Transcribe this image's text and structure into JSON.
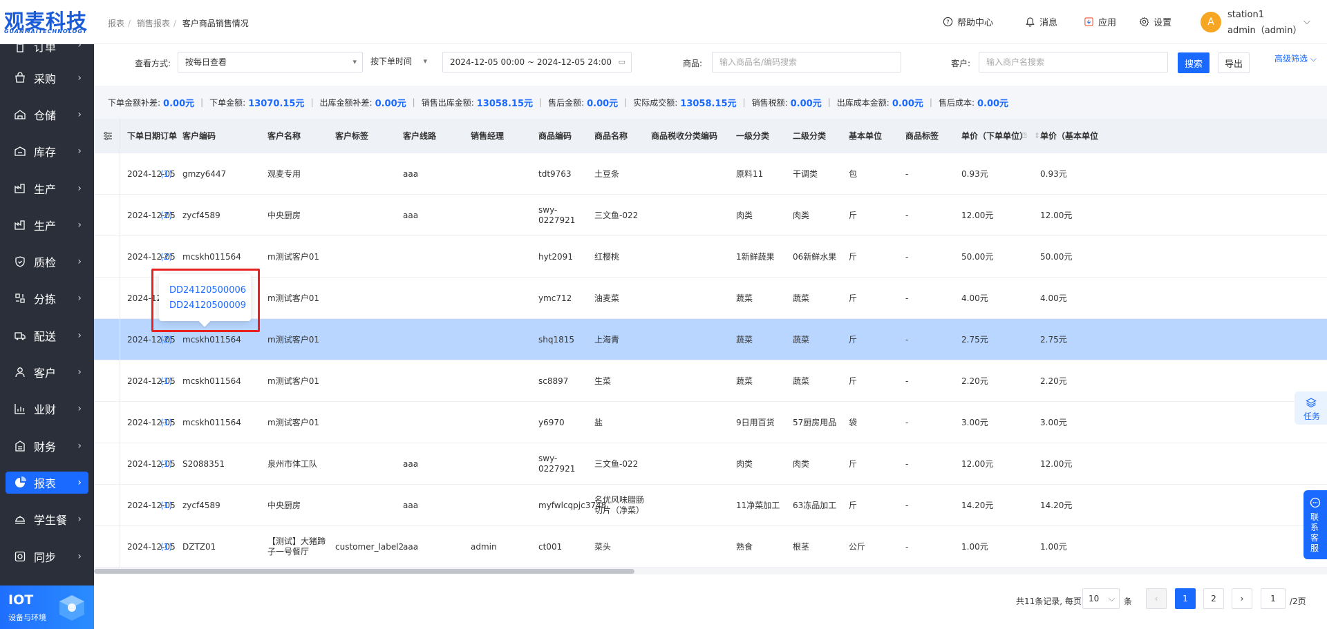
{
  "brand": {
    "name_cn": "观麦科技",
    "name_en": "GUANMAITECHNOLOGY",
    "color": "#1a5bd9"
  },
  "sidebar": {
    "items": [
      {
        "label": "订单",
        "icon": "clipboard-icon"
      },
      {
        "label": "采购",
        "icon": "bag-icon"
      },
      {
        "label": "仓储",
        "icon": "warehouse-icon"
      },
      {
        "label": "库存",
        "icon": "inventory-icon"
      },
      {
        "label": "生产",
        "icon": "factory-icon"
      },
      {
        "label": "生产",
        "icon": "factory-icon"
      },
      {
        "label": "质检",
        "icon": "shield-icon"
      },
      {
        "label": "分拣",
        "icon": "sort-icon"
      },
      {
        "label": "配送",
        "icon": "truck-icon"
      },
      {
        "label": "客户",
        "icon": "user-icon"
      },
      {
        "label": "业财",
        "icon": "chart-bar-icon"
      },
      {
        "label": "财务",
        "icon": "finance-icon"
      },
      {
        "label": "报表",
        "icon": "pie-chart-icon"
      },
      {
        "label": "学生餐",
        "icon": "meal-icon"
      },
      {
        "label": "同步",
        "icon": "sync-icon"
      }
    ],
    "active_index": 12,
    "iot": {
      "title": "IOT",
      "subtitle": "设备与环境"
    }
  },
  "header": {
    "breadcrumb": [
      "报表",
      "销售报表",
      "客户商品销售情况"
    ],
    "help": "帮助中心",
    "messages": "消息",
    "apps": "应用",
    "settings": "设置",
    "user": {
      "avatar_letter": "A",
      "name": "station1",
      "role": "admin（admin）"
    }
  },
  "filters": {
    "view_label": "查看方式:",
    "view_value": "按每日查看",
    "time_type": "按下单时间",
    "date_range": "2024-12-05 00:00 ~ 2024-12-05 24:00",
    "product_label": "商品:",
    "product_placeholder": "输入商品名/编码搜索",
    "customer_label": "客户:",
    "customer_placeholder": "输入商户名搜索",
    "search_btn": "搜索",
    "export_btn": "导出",
    "advanced": "高级筛选"
  },
  "summary": [
    {
      "label": "下单金额补差:",
      "value": "0.00元"
    },
    {
      "label": "下单金额:",
      "value": "13070.15元"
    },
    {
      "label": "出库金额补差:",
      "value": "0.00元"
    },
    {
      "label": "销售出库金额:",
      "value": "13058.15元"
    },
    {
      "label": "售后金额:",
      "value": "0.00元"
    },
    {
      "label": "实际成交额:",
      "value": "13058.15元"
    },
    {
      "label": "销售税额:",
      "value": "0.00元"
    },
    {
      "label": "出库成本金额:",
      "value": "0.00元"
    },
    {
      "label": "售后成本:",
      "value": "0.00元"
    }
  ],
  "table": {
    "columns": [
      "下单日期",
      "订单",
      "客户编码",
      "客户名称",
      "客户标签",
      "客户线路",
      "销售经理",
      "商品编码",
      "商品名称",
      "商品税收分类编码",
      "一级分类",
      "二级分类",
      "基本单位",
      "商品标签",
      "单价（下单单位）",
      "单价（基本单位"
    ],
    "rows": [
      [
        "2024-12-05",
        "(1)",
        "gmzy6447",
        "观麦专用",
        "",
        "aaa",
        "",
        "tdt9763",
        "土豆条",
        "",
        "原料11",
        "干调类",
        "包",
        "-",
        "0.93元",
        "0.93元"
      ],
      [
        "2024-12-05",
        "(2)",
        "zycf4589",
        "中央厨房",
        "",
        "aaa",
        "",
        "swy-0227921",
        "三文鱼-022",
        "",
        "肉类",
        "肉类",
        "斤",
        "-",
        "12.00元",
        "12.00元"
      ],
      [
        "2024-12-05",
        "(2)",
        "mcskh011564",
        "m测试客户01",
        "",
        "",
        "",
        "hyt2091",
        "红樱桃",
        "",
        "1新鲜蔬果",
        "06新鲜水果",
        "斤",
        "-",
        "50.00元",
        "50.00元"
      ],
      [
        "2024-12-05",
        "(2)",
        "mcskh011564",
        "m测试客户01",
        "",
        "",
        "",
        "ymc712",
        "油麦菜",
        "",
        "蔬菜",
        "蔬菜",
        "斤",
        "-",
        "4.00元",
        "4.00元"
      ],
      [
        "2024-12-05",
        "(2)",
        "mcskh011564",
        "m测试客户01",
        "",
        "",
        "",
        "shq1815",
        "上海青",
        "",
        "蔬菜",
        "蔬菜",
        "斤",
        "-",
        "2.75元",
        "2.75元"
      ],
      [
        "2024-12-05",
        "(1)",
        "mcskh011564",
        "m测试客户01",
        "",
        "",
        "",
        "sc8897",
        "生菜",
        "",
        "蔬菜",
        "蔬菜",
        "斤",
        "-",
        "2.20元",
        "2.20元"
      ],
      [
        "2024-12-05",
        "(1)",
        "mcskh011564",
        "m测试客户01",
        "",
        "",
        "",
        "y6970",
        "盐",
        "",
        "9日用百货",
        "57厨房用品",
        "袋",
        "-",
        "3.00元",
        "3.00元"
      ],
      [
        "2024-12-05",
        "(1)",
        "S2088351",
        "泉州市体工队",
        "",
        "aaa",
        "",
        "swy-0227921",
        "三文鱼-022",
        "",
        "肉类",
        "肉类",
        "斤",
        "-",
        "12.00元",
        "12.00元"
      ],
      [
        "2024-12-05",
        "(1)",
        "zycf4589",
        "中央厨房",
        "",
        "aaa",
        "",
        "myfwlcqpjc3748",
        "名优风味腊肠切片（净菜）",
        "",
        "11净菜加工",
        "63冻品加工",
        "斤",
        "-",
        "14.20元",
        "14.20元"
      ],
      [
        "2024-12-05",
        "(1)",
        "DZTZ01",
        "【测试】大猪蹄子一号餐厅",
        "customer_label2",
        "aaa",
        "admin",
        "ct001",
        "菜头",
        "",
        "熟食",
        "根茎",
        "公斤",
        "-",
        "1.00元",
        "1.00元"
      ]
    ],
    "selected_row": 4
  },
  "popover": {
    "links": [
      "DD24120500006",
      "DD24120500009"
    ]
  },
  "pagination": {
    "total_text": "共11条记录, 每页",
    "page_size": "10",
    "unit": "条",
    "prev": "‹",
    "pages": [
      "1",
      "2"
    ],
    "next": "›",
    "jump_value": "1",
    "total_pages": "/2页"
  },
  "floating": {
    "task": "任务",
    "service": "联系客服"
  },
  "colors": {
    "primary": "#1a6aff",
    "sidebar_bg": "#2b2f3a",
    "selected_row": "#b8d6ff",
    "highlight": "#e8201f"
  }
}
